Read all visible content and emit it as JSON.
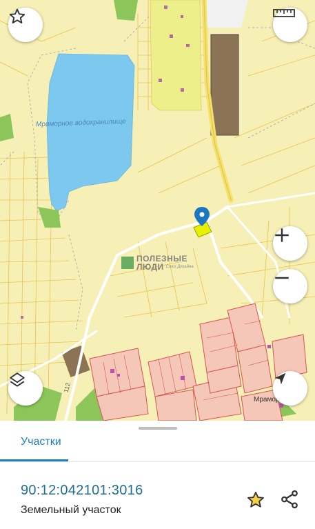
{
  "map": {
    "reservoir_label": "Мраморное водохранилище",
    "village_label": "Мраморное",
    "road_label": "112",
    "watermark": {
      "title_line1": "ПОЛЕЗНЫЕ",
      "title_line2": "ЛЮДИ",
      "subtitle": "Союз Дизайна"
    },
    "controls": {
      "favorites": "star-icon",
      "measure": "ruler-icon",
      "zoom_in": "plus-icon",
      "zoom_out": "minus-icon",
      "layers": "layers-icon",
      "locate": "navigation-arrow-icon"
    },
    "colors": {
      "background": "#f7f0b6",
      "water": "#7cc8ef",
      "parcel_outline": "#e8c24a",
      "built_up_outline": "#d9534f",
      "road": "#ffffff",
      "highway": "#f5e06a",
      "selected_parcel": "#e6f000",
      "marker": "#1a78c2",
      "building": "#8b7355"
    }
  },
  "sheet": {
    "tab_label": "Участки",
    "cadastral_number": "90:12:042101:3016",
    "parcel_type": "Земельный участок",
    "accent_color": "#1d7fb8"
  }
}
